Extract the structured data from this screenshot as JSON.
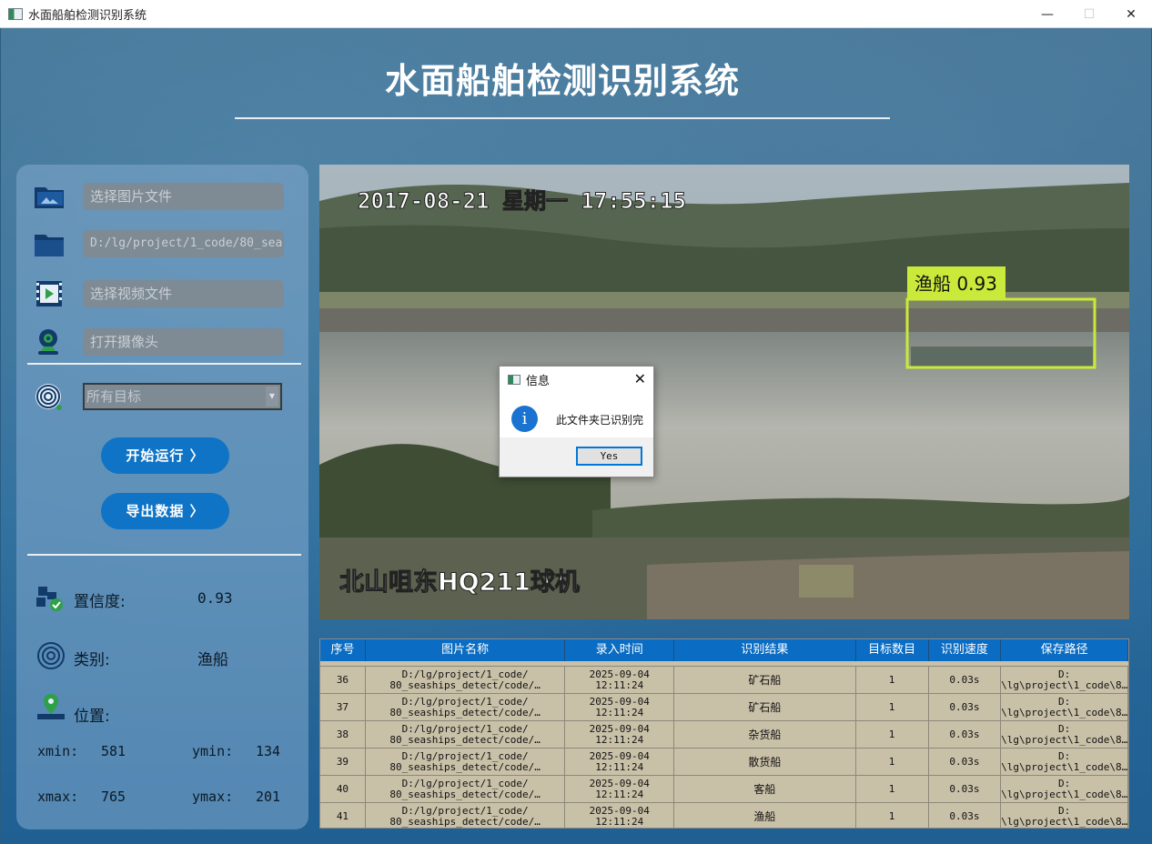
{
  "window": {
    "title": "水面船舶检测识别系统",
    "minimize": "—",
    "maximize": "☐",
    "close": "✕"
  },
  "header": {
    "title": "水面船舶检测识别系统"
  },
  "inputs": {
    "image_file_placeholder": "选择图片文件",
    "folder_path": "D:/lg/project/1_code/80_sea",
    "video_file_placeholder": "选择视频文件",
    "camera_placeholder": "打开摄像头",
    "target_select": "所有目标",
    "target_select_arrow": "▼"
  },
  "buttons": {
    "start": "开始运行 〉",
    "export": "导出数据 〉"
  },
  "result": {
    "confidence_label": "置信度:",
    "confidence_value": "0.93",
    "class_label": "类别:",
    "class_value": "渔船",
    "position_label": "位置:",
    "xmin_label": "xmin:",
    "xmin_value": "581",
    "ymin_label": "ymin:",
    "ymin_value": "134",
    "xmax_label": "xmax:",
    "xmax_value": "765",
    "ymax_label": "ymax:",
    "ymax_value": "201"
  },
  "viewer": {
    "timestamp": "2017-08-21 星期一 17:55:15",
    "caption": "北山咀东HQ211球机",
    "detection_label": "渔船 0.93"
  },
  "table": {
    "headers": [
      "序号",
      "图片名称",
      "录入时间",
      "识别结果",
      "目标数目",
      "识别速度",
      "保存路径"
    ],
    "rows": [
      [
        "36",
        "D:/lg/project/1_code/\n80_seaships_detect/code/…",
        "2025-09-04\n12:11:24",
        "矿石船",
        "1",
        "0.03s",
        "D:\n\\lg\\project\\1_code\\8…"
      ],
      [
        "37",
        "D:/lg/project/1_code/\n80_seaships_detect/code/…",
        "2025-09-04\n12:11:24",
        "矿石船",
        "1",
        "0.03s",
        "D:\n\\lg\\project\\1_code\\8…"
      ],
      [
        "38",
        "D:/lg/project/1_code/\n80_seaships_detect/code/…",
        "2025-09-04\n12:11:24",
        "杂货船",
        "1",
        "0.03s",
        "D:\n\\lg\\project\\1_code\\8…"
      ],
      [
        "39",
        "D:/lg/project/1_code/\n80_seaships_detect/code/…",
        "2025-09-04\n12:11:24",
        "散货船",
        "1",
        "0.03s",
        "D:\n\\lg\\project\\1_code\\8…"
      ],
      [
        "40",
        "D:/lg/project/1_code/\n80_seaships_detect/code/…",
        "2025-09-04\n12:11:24",
        "客船",
        "1",
        "0.03s",
        "D:\n\\lg\\project\\1_code\\8…"
      ],
      [
        "41",
        "D:/lg/project/1_code/\n80_seaships_detect/code/…",
        "2025-09-04\n12:11:24",
        "渔船",
        "1",
        "0.03s",
        "D:\n\\lg\\project\\1_code\\8…"
      ]
    ]
  },
  "dialog": {
    "title": "信息",
    "close": "✕",
    "icon_glyph": "i",
    "message": "此文件夹已识别完",
    "yes": "Yes"
  },
  "colors": {
    "accent_button": "#0f74c6",
    "table_header": "#0a6cc3",
    "detection_box": "#c9ea3a"
  }
}
